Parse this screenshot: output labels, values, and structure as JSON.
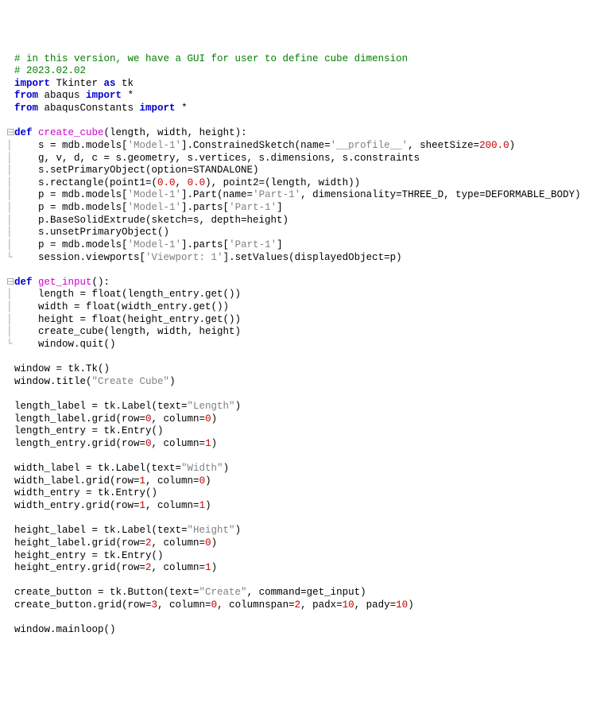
{
  "lines": [
    {
      "fold": " ",
      "segs": [
        {
          "t": "# in this version, we have a GUI for user to define cube dimension",
          "c": "c-comment"
        }
      ]
    },
    {
      "fold": " ",
      "segs": [
        {
          "t": "# 2023.02.02",
          "c": "c-comment"
        }
      ]
    },
    {
      "fold": " ",
      "segs": [
        {
          "t": "import",
          "c": "c-keyword"
        },
        {
          "t": " Tkinter ",
          "c": "c-id"
        },
        {
          "t": "as",
          "c": "c-keyword"
        },
        {
          "t": " tk",
          "c": "c-id"
        }
      ]
    },
    {
      "fold": " ",
      "segs": [
        {
          "t": "from",
          "c": "c-keyword"
        },
        {
          "t": " abaqus ",
          "c": "c-id"
        },
        {
          "t": "import",
          "c": "c-keyword"
        },
        {
          "t": " *",
          "c": "c-op"
        }
      ]
    },
    {
      "fold": " ",
      "segs": [
        {
          "t": "from",
          "c": "c-keyword"
        },
        {
          "t": " abaqusConstants ",
          "c": "c-id"
        },
        {
          "t": "import",
          "c": "c-keyword"
        },
        {
          "t": " *",
          "c": "c-op"
        }
      ]
    },
    {
      "fold": " ",
      "segs": [
        {
          "t": "",
          "c": "c-id"
        }
      ]
    },
    {
      "fold": "⊟",
      "segs": [
        {
          "t": "def",
          "c": "c-keyword"
        },
        {
          "t": " ",
          "c": "c-id"
        },
        {
          "t": "create_cube",
          "c": "c-def"
        },
        {
          "t": "(length, width, height):",
          "c": "c-id"
        }
      ]
    },
    {
      "fold": "│",
      "segs": [
        {
          "t": "    s = mdb.models[",
          "c": "c-id"
        },
        {
          "t": "'Model-1'",
          "c": "c-str"
        },
        {
          "t": "].ConstrainedSketch(name=",
          "c": "c-id"
        },
        {
          "t": "'__profile__'",
          "c": "c-str"
        },
        {
          "t": ", sheetSize=",
          "c": "c-id"
        },
        {
          "t": "200.0",
          "c": "c-num"
        },
        {
          "t": ")",
          "c": "c-id"
        }
      ]
    },
    {
      "fold": "│",
      "segs": [
        {
          "t": "    g, v, d, c = s.geometry, s.vertices, s.dimensions, s.constraints",
          "c": "c-id"
        }
      ]
    },
    {
      "fold": "│",
      "segs": [
        {
          "t": "    s.setPrimaryObject(option=STANDALONE)",
          "c": "c-id"
        }
      ]
    },
    {
      "fold": "│",
      "segs": [
        {
          "t": "    s.rectangle(point1=(",
          "c": "c-id"
        },
        {
          "t": "0.0",
          "c": "c-num"
        },
        {
          "t": ", ",
          "c": "c-id"
        },
        {
          "t": "0.0",
          "c": "c-num"
        },
        {
          "t": "), point2=(length, width))",
          "c": "c-id"
        }
      ]
    },
    {
      "fold": "│",
      "segs": [
        {
          "t": "    p = mdb.models[",
          "c": "c-id"
        },
        {
          "t": "'Model-1'",
          "c": "c-str"
        },
        {
          "t": "].Part(name=",
          "c": "c-id"
        },
        {
          "t": "'Part-1'",
          "c": "c-str"
        },
        {
          "t": ", dimensionality=THREE_D, type=DEFORMABLE_BODY)",
          "c": "c-id"
        }
      ]
    },
    {
      "fold": "│",
      "segs": [
        {
          "t": "    p = mdb.models[",
          "c": "c-id"
        },
        {
          "t": "'Model-1'",
          "c": "c-str"
        },
        {
          "t": "].parts[",
          "c": "c-id"
        },
        {
          "t": "'Part-1'",
          "c": "c-str"
        },
        {
          "t": "]",
          "c": "c-id"
        }
      ]
    },
    {
      "fold": "│",
      "segs": [
        {
          "t": "    p.BaseSolidExtrude(sketch=s, depth=height)",
          "c": "c-id"
        }
      ]
    },
    {
      "fold": "│",
      "segs": [
        {
          "t": "    s.unsetPrimaryObject()",
          "c": "c-id"
        }
      ]
    },
    {
      "fold": "│",
      "segs": [
        {
          "t": "    p = mdb.models[",
          "c": "c-id"
        },
        {
          "t": "'Model-1'",
          "c": "c-str"
        },
        {
          "t": "].parts[",
          "c": "c-id"
        },
        {
          "t": "'Part-1'",
          "c": "c-str"
        },
        {
          "t": "]",
          "c": "c-id"
        }
      ]
    },
    {
      "fold": "└",
      "segs": [
        {
          "t": "    session.viewports[",
          "c": "c-id"
        },
        {
          "t": "'Viewport: 1'",
          "c": "c-str"
        },
        {
          "t": "].setValues(displayedObject=p)",
          "c": "c-id"
        }
      ]
    },
    {
      "fold": " ",
      "segs": [
        {
          "t": "",
          "c": "c-id"
        }
      ]
    },
    {
      "fold": "⊟",
      "segs": [
        {
          "t": "def",
          "c": "c-keyword"
        },
        {
          "t": " ",
          "c": "c-id"
        },
        {
          "t": "get_input",
          "c": "c-def"
        },
        {
          "t": "():",
          "c": "c-id"
        }
      ]
    },
    {
      "fold": "│",
      "segs": [
        {
          "t": "    length = float(length_entry.get())",
          "c": "c-id"
        }
      ]
    },
    {
      "fold": "│",
      "segs": [
        {
          "t": "    width = float(width_entry.get())",
          "c": "c-id"
        }
      ]
    },
    {
      "fold": "│",
      "segs": [
        {
          "t": "    height = float(height_entry.get())",
          "c": "c-id"
        }
      ]
    },
    {
      "fold": "│",
      "segs": [
        {
          "t": "    create_cube(length, width, height)",
          "c": "c-id"
        }
      ]
    },
    {
      "fold": "└",
      "segs": [
        {
          "t": "    window.quit()",
          "c": "c-id"
        }
      ]
    },
    {
      "fold": " ",
      "segs": [
        {
          "t": "",
          "c": "c-id"
        }
      ]
    },
    {
      "fold": " ",
      "segs": [
        {
          "t": "window = tk.Tk()",
          "c": "c-id"
        }
      ]
    },
    {
      "fold": " ",
      "segs": [
        {
          "t": "window.title(",
          "c": "c-id"
        },
        {
          "t": "\"Create Cube\"",
          "c": "c-str"
        },
        {
          "t": ")",
          "c": "c-id"
        }
      ]
    },
    {
      "fold": " ",
      "segs": [
        {
          "t": "",
          "c": "c-id"
        }
      ]
    },
    {
      "fold": " ",
      "segs": [
        {
          "t": "length_label = tk.Label(text=",
          "c": "c-id"
        },
        {
          "t": "\"Length\"",
          "c": "c-str"
        },
        {
          "t": ")",
          "c": "c-id"
        }
      ]
    },
    {
      "fold": " ",
      "segs": [
        {
          "t": "length_label.grid(row=",
          "c": "c-id"
        },
        {
          "t": "0",
          "c": "c-num"
        },
        {
          "t": ", column=",
          "c": "c-id"
        },
        {
          "t": "0",
          "c": "c-num"
        },
        {
          "t": ")",
          "c": "c-id"
        }
      ]
    },
    {
      "fold": " ",
      "segs": [
        {
          "t": "length_entry = tk.Entry()",
          "c": "c-id"
        }
      ]
    },
    {
      "fold": " ",
      "segs": [
        {
          "t": "length_entry.grid(row=",
          "c": "c-id"
        },
        {
          "t": "0",
          "c": "c-num"
        },
        {
          "t": ", column=",
          "c": "c-id"
        },
        {
          "t": "1",
          "c": "c-num"
        },
        {
          "t": ")",
          "c": "c-id"
        }
      ]
    },
    {
      "fold": " ",
      "segs": [
        {
          "t": "",
          "c": "c-id"
        }
      ]
    },
    {
      "fold": " ",
      "segs": [
        {
          "t": "width_label = tk.Label(text=",
          "c": "c-id"
        },
        {
          "t": "\"Width\"",
          "c": "c-str"
        },
        {
          "t": ")",
          "c": "c-id"
        }
      ]
    },
    {
      "fold": " ",
      "segs": [
        {
          "t": "width_label.grid(row=",
          "c": "c-id"
        },
        {
          "t": "1",
          "c": "c-num"
        },
        {
          "t": ", column=",
          "c": "c-id"
        },
        {
          "t": "0",
          "c": "c-num"
        },
        {
          "t": ")",
          "c": "c-id"
        }
      ]
    },
    {
      "fold": " ",
      "segs": [
        {
          "t": "width_entry = tk.Entry()",
          "c": "c-id"
        }
      ]
    },
    {
      "fold": " ",
      "segs": [
        {
          "t": "width_entry.grid(row=",
          "c": "c-id"
        },
        {
          "t": "1",
          "c": "c-num"
        },
        {
          "t": ", column=",
          "c": "c-id"
        },
        {
          "t": "1",
          "c": "c-num"
        },
        {
          "t": ")",
          "c": "c-id"
        }
      ]
    },
    {
      "fold": " ",
      "segs": [
        {
          "t": "",
          "c": "c-id"
        }
      ]
    },
    {
      "fold": " ",
      "segs": [
        {
          "t": "height_label = tk.Label(text=",
          "c": "c-id"
        },
        {
          "t": "\"Height\"",
          "c": "c-str"
        },
        {
          "t": ")",
          "c": "c-id"
        }
      ]
    },
    {
      "fold": " ",
      "segs": [
        {
          "t": "height_label.grid(row=",
          "c": "c-id"
        },
        {
          "t": "2",
          "c": "c-num"
        },
        {
          "t": ", column=",
          "c": "c-id"
        },
        {
          "t": "0",
          "c": "c-num"
        },
        {
          "t": ")",
          "c": "c-id"
        }
      ]
    },
    {
      "fold": " ",
      "segs": [
        {
          "t": "height_entry = tk.Entry()",
          "c": "c-id"
        }
      ]
    },
    {
      "fold": " ",
      "segs": [
        {
          "t": "height_entry.grid(row=",
          "c": "c-id"
        },
        {
          "t": "2",
          "c": "c-num"
        },
        {
          "t": ", column=",
          "c": "c-id"
        },
        {
          "t": "1",
          "c": "c-num"
        },
        {
          "t": ")",
          "c": "c-id"
        }
      ]
    },
    {
      "fold": " ",
      "segs": [
        {
          "t": "",
          "c": "c-id"
        }
      ]
    },
    {
      "fold": " ",
      "segs": [
        {
          "t": "create_button = tk.Button(text=",
          "c": "c-id"
        },
        {
          "t": "\"Create\"",
          "c": "c-str"
        },
        {
          "t": ", command=get_input)",
          "c": "c-id"
        }
      ]
    },
    {
      "fold": " ",
      "segs": [
        {
          "t": "create_button.grid(row=",
          "c": "c-id"
        },
        {
          "t": "3",
          "c": "c-num"
        },
        {
          "t": ", column=",
          "c": "c-id"
        },
        {
          "t": "0",
          "c": "c-num"
        },
        {
          "t": ", columnspan=",
          "c": "c-id"
        },
        {
          "t": "2",
          "c": "c-num"
        },
        {
          "t": ", padx=",
          "c": "c-id"
        },
        {
          "t": "10",
          "c": "c-num"
        },
        {
          "t": ", pady=",
          "c": "c-id"
        },
        {
          "t": "10",
          "c": "c-num"
        },
        {
          "t": ")",
          "c": "c-id"
        }
      ]
    },
    {
      "fold": " ",
      "segs": [
        {
          "t": "",
          "c": "c-id"
        }
      ]
    },
    {
      "fold": " ",
      "segs": [
        {
          "t": "window.mainloop()",
          "c": "c-id"
        }
      ]
    }
  ]
}
